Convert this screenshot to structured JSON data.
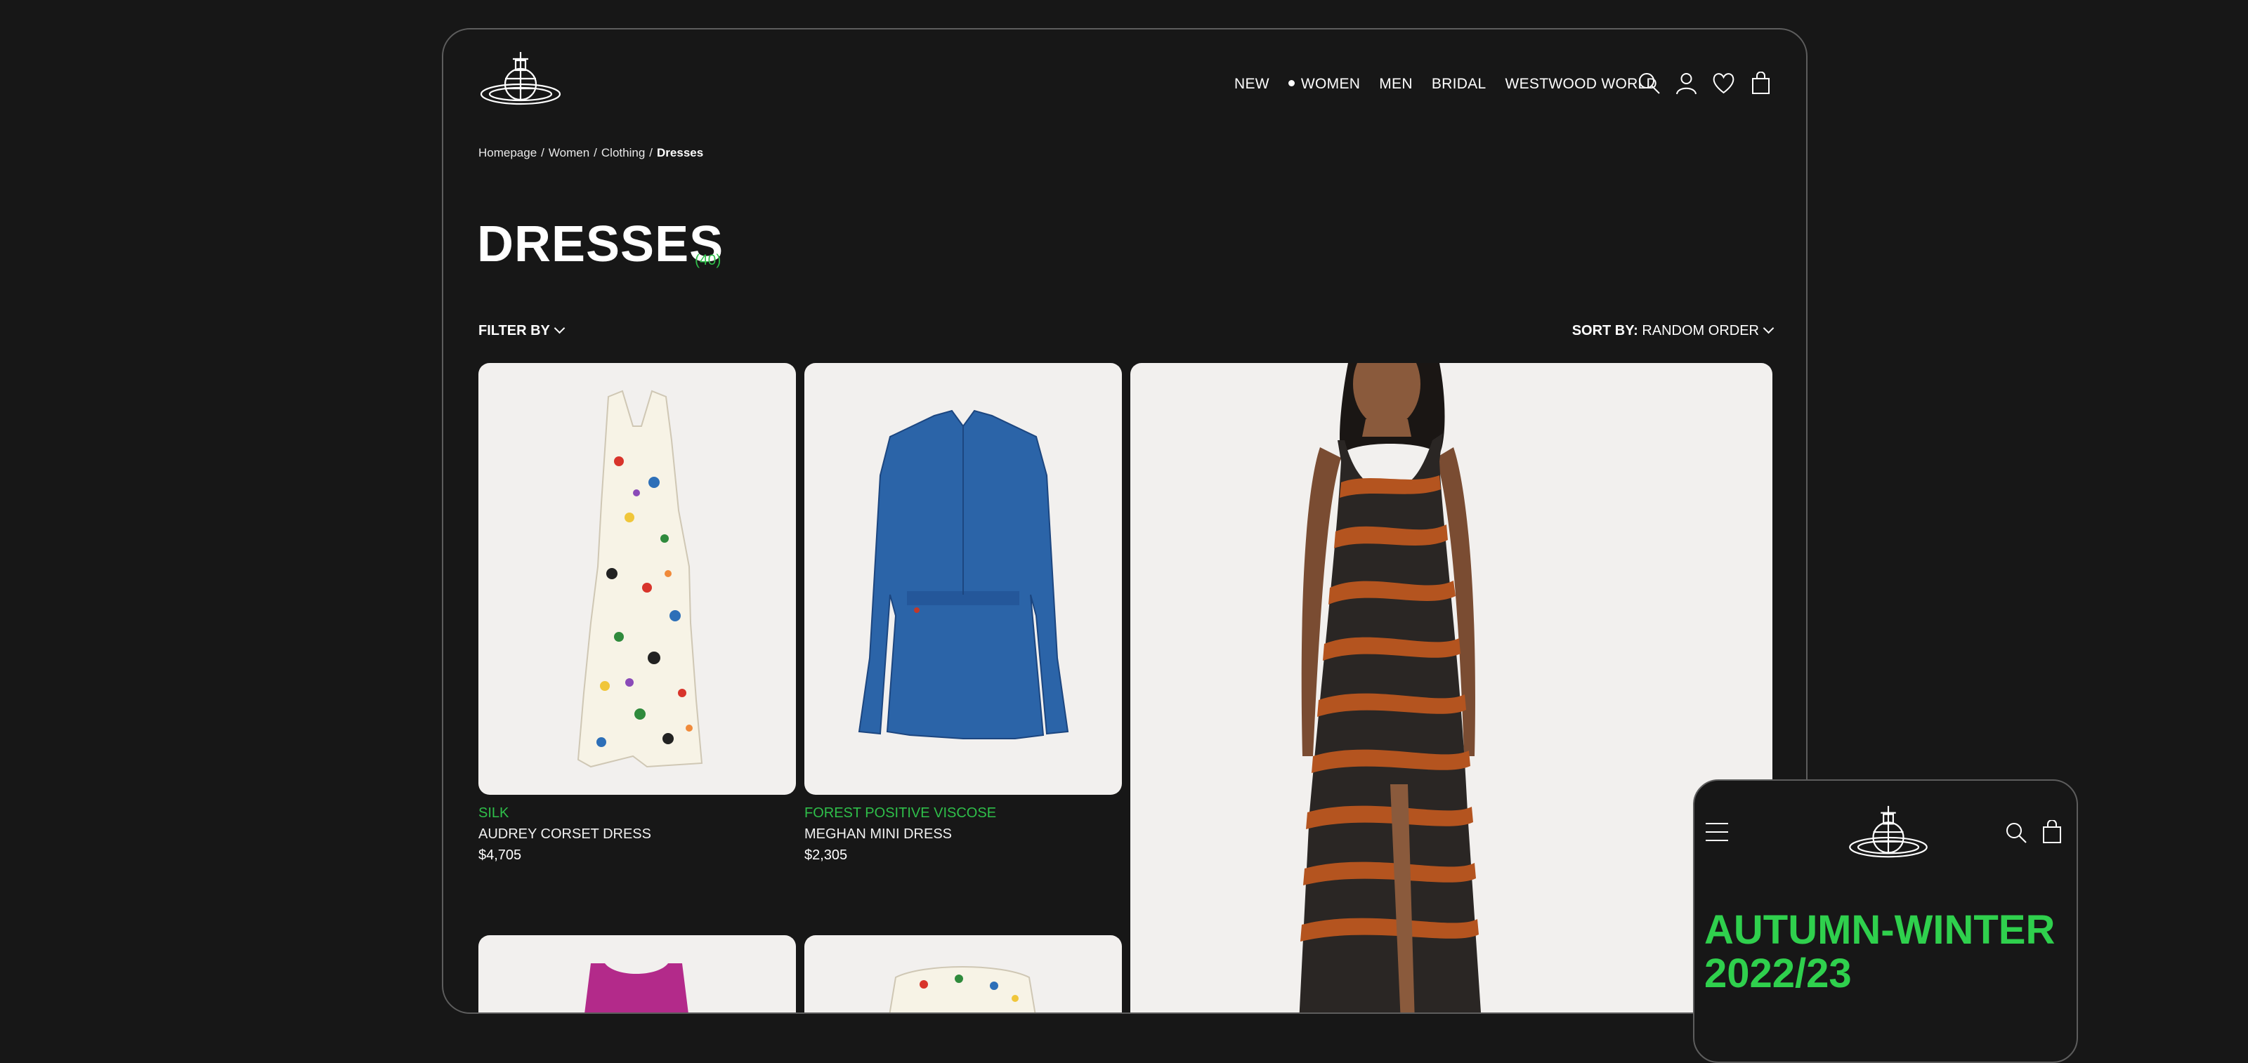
{
  "header": {
    "nav": [
      "NEW",
      "WOMEN",
      "MEN",
      "BRIDAL",
      "WESTWOOD WORLD"
    ],
    "icons": [
      "search-icon",
      "account-icon",
      "heart-icon",
      "bag-icon"
    ]
  },
  "breadcrumb": [
    "Homepage",
    "Women",
    "Clothing",
    "Dresses"
  ],
  "page": {
    "title": "DRESSES",
    "count": "(40)"
  },
  "toolbar": {
    "filter_label": "FILTER BY",
    "sort_label": "SORT BY:",
    "sort_value": "RANDOM ORDER"
  },
  "products": [
    {
      "material": "SILK",
      "name": "AUDREY CORSET DRESS",
      "price": "$4,705"
    },
    {
      "material": "FOREST POSITIVE VISCOSE",
      "name": "MEGHAN MINI DRESS",
      "price": "$2,305"
    }
  ],
  "mobile": {
    "headline_line1": "AUTUMN-WINTER",
    "headline_line2": "2022/23"
  },
  "colors": {
    "background": "#171717",
    "accent": "#2fbf4a",
    "card": "#f2f0ee"
  }
}
